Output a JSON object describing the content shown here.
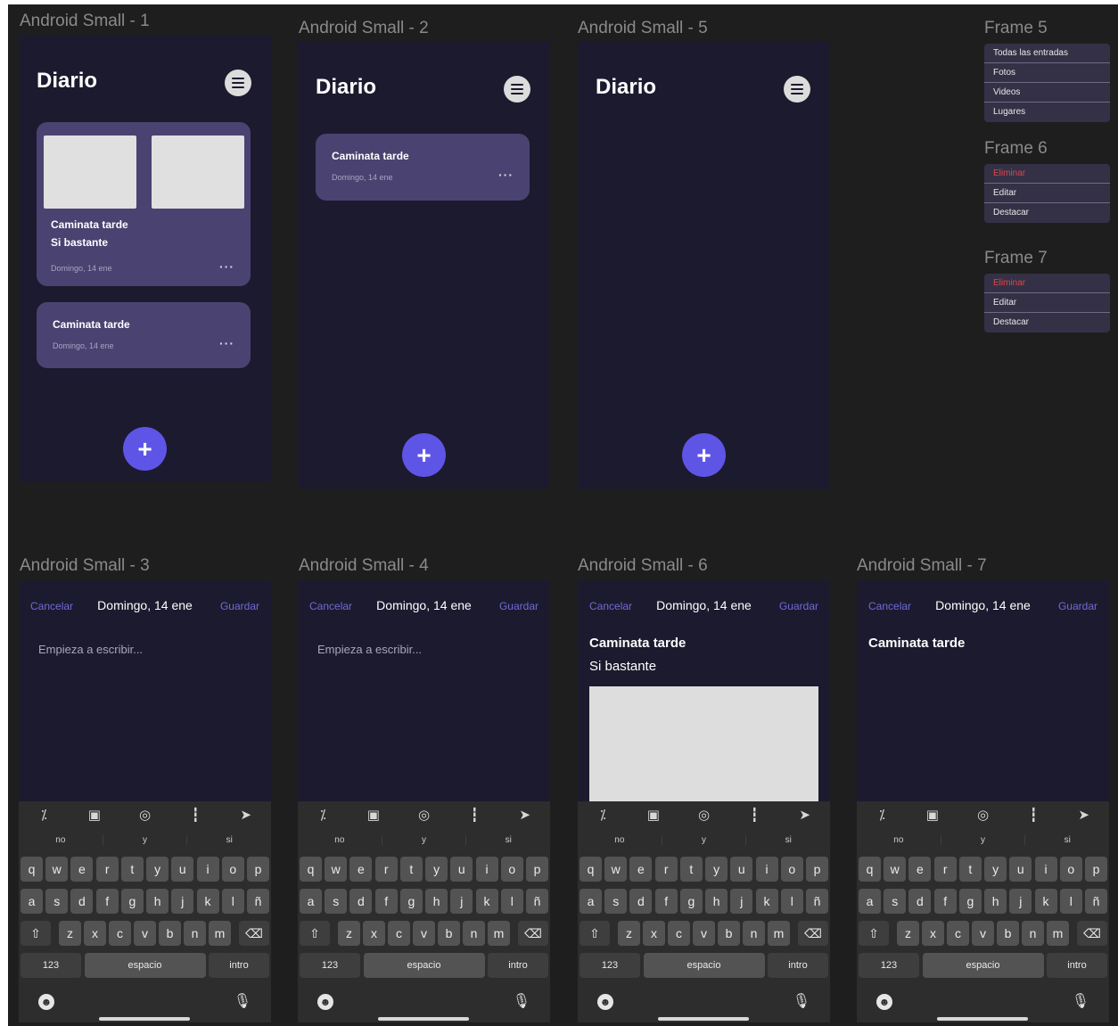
{
  "frames_top": [
    {
      "label": "Android Small - 1"
    },
    {
      "label": "Android Small - 2"
    },
    {
      "label": "Android Small - 5"
    }
  ],
  "diary": {
    "title": "Diario",
    "fab_label": "+",
    "card_title": "Caminata tarde",
    "card_title_line2": "Si bastante",
    "card_date": "Domingo, 14 ene",
    "card_more": "···"
  },
  "frames_bottom": [
    {
      "label": "Android Small - 3"
    },
    {
      "label": "Android Small - 4"
    },
    {
      "label": "Android Small - 6"
    },
    {
      "label": "Android Small - 7"
    }
  ],
  "editor": {
    "cancel": "Cancelar",
    "date": "Domingo, 14 ene",
    "save": "Guardar",
    "placeholder": "Empieza a escribir...",
    "entry_title": "Caminata tarde",
    "entry_body": "Si bastante"
  },
  "keyboard": {
    "toolbar_icons": [
      "magic-wand-icon",
      "gallery-icon",
      "camera-icon",
      "audio-wave-icon",
      "location-arrow-icon"
    ],
    "toolbar_glyphs": [
      "⁒",
      "▣",
      "◎",
      "┇",
      "➤"
    ],
    "suggestions": [
      "no",
      "y",
      "si"
    ],
    "row1": [
      "q",
      "w",
      "e",
      "r",
      "t",
      "y",
      "u",
      "i",
      "o",
      "p"
    ],
    "row2": [
      "a",
      "s",
      "d",
      "f",
      "g",
      "h",
      "j",
      "k",
      "l",
      "ñ"
    ],
    "row3": [
      "z",
      "x",
      "c",
      "v",
      "b",
      "n",
      "m"
    ],
    "shift": "⇧",
    "backspace": "⌫",
    "numbers": "123",
    "space": "espacio",
    "enter": "intro",
    "emoji": "☻",
    "mic": "🎙"
  },
  "menus": [
    {
      "label": "Frame 5",
      "items": [
        "Todas las entradas",
        "Fotos",
        "Videos",
        "Lugares"
      ]
    },
    {
      "label": "Frame 6",
      "items": [
        "Eliminar",
        "Editar",
        "Destacar"
      ]
    },
    {
      "label": "Frame 7",
      "items": [
        "Eliminar",
        "Editar",
        "Destacar"
      ]
    }
  ]
}
